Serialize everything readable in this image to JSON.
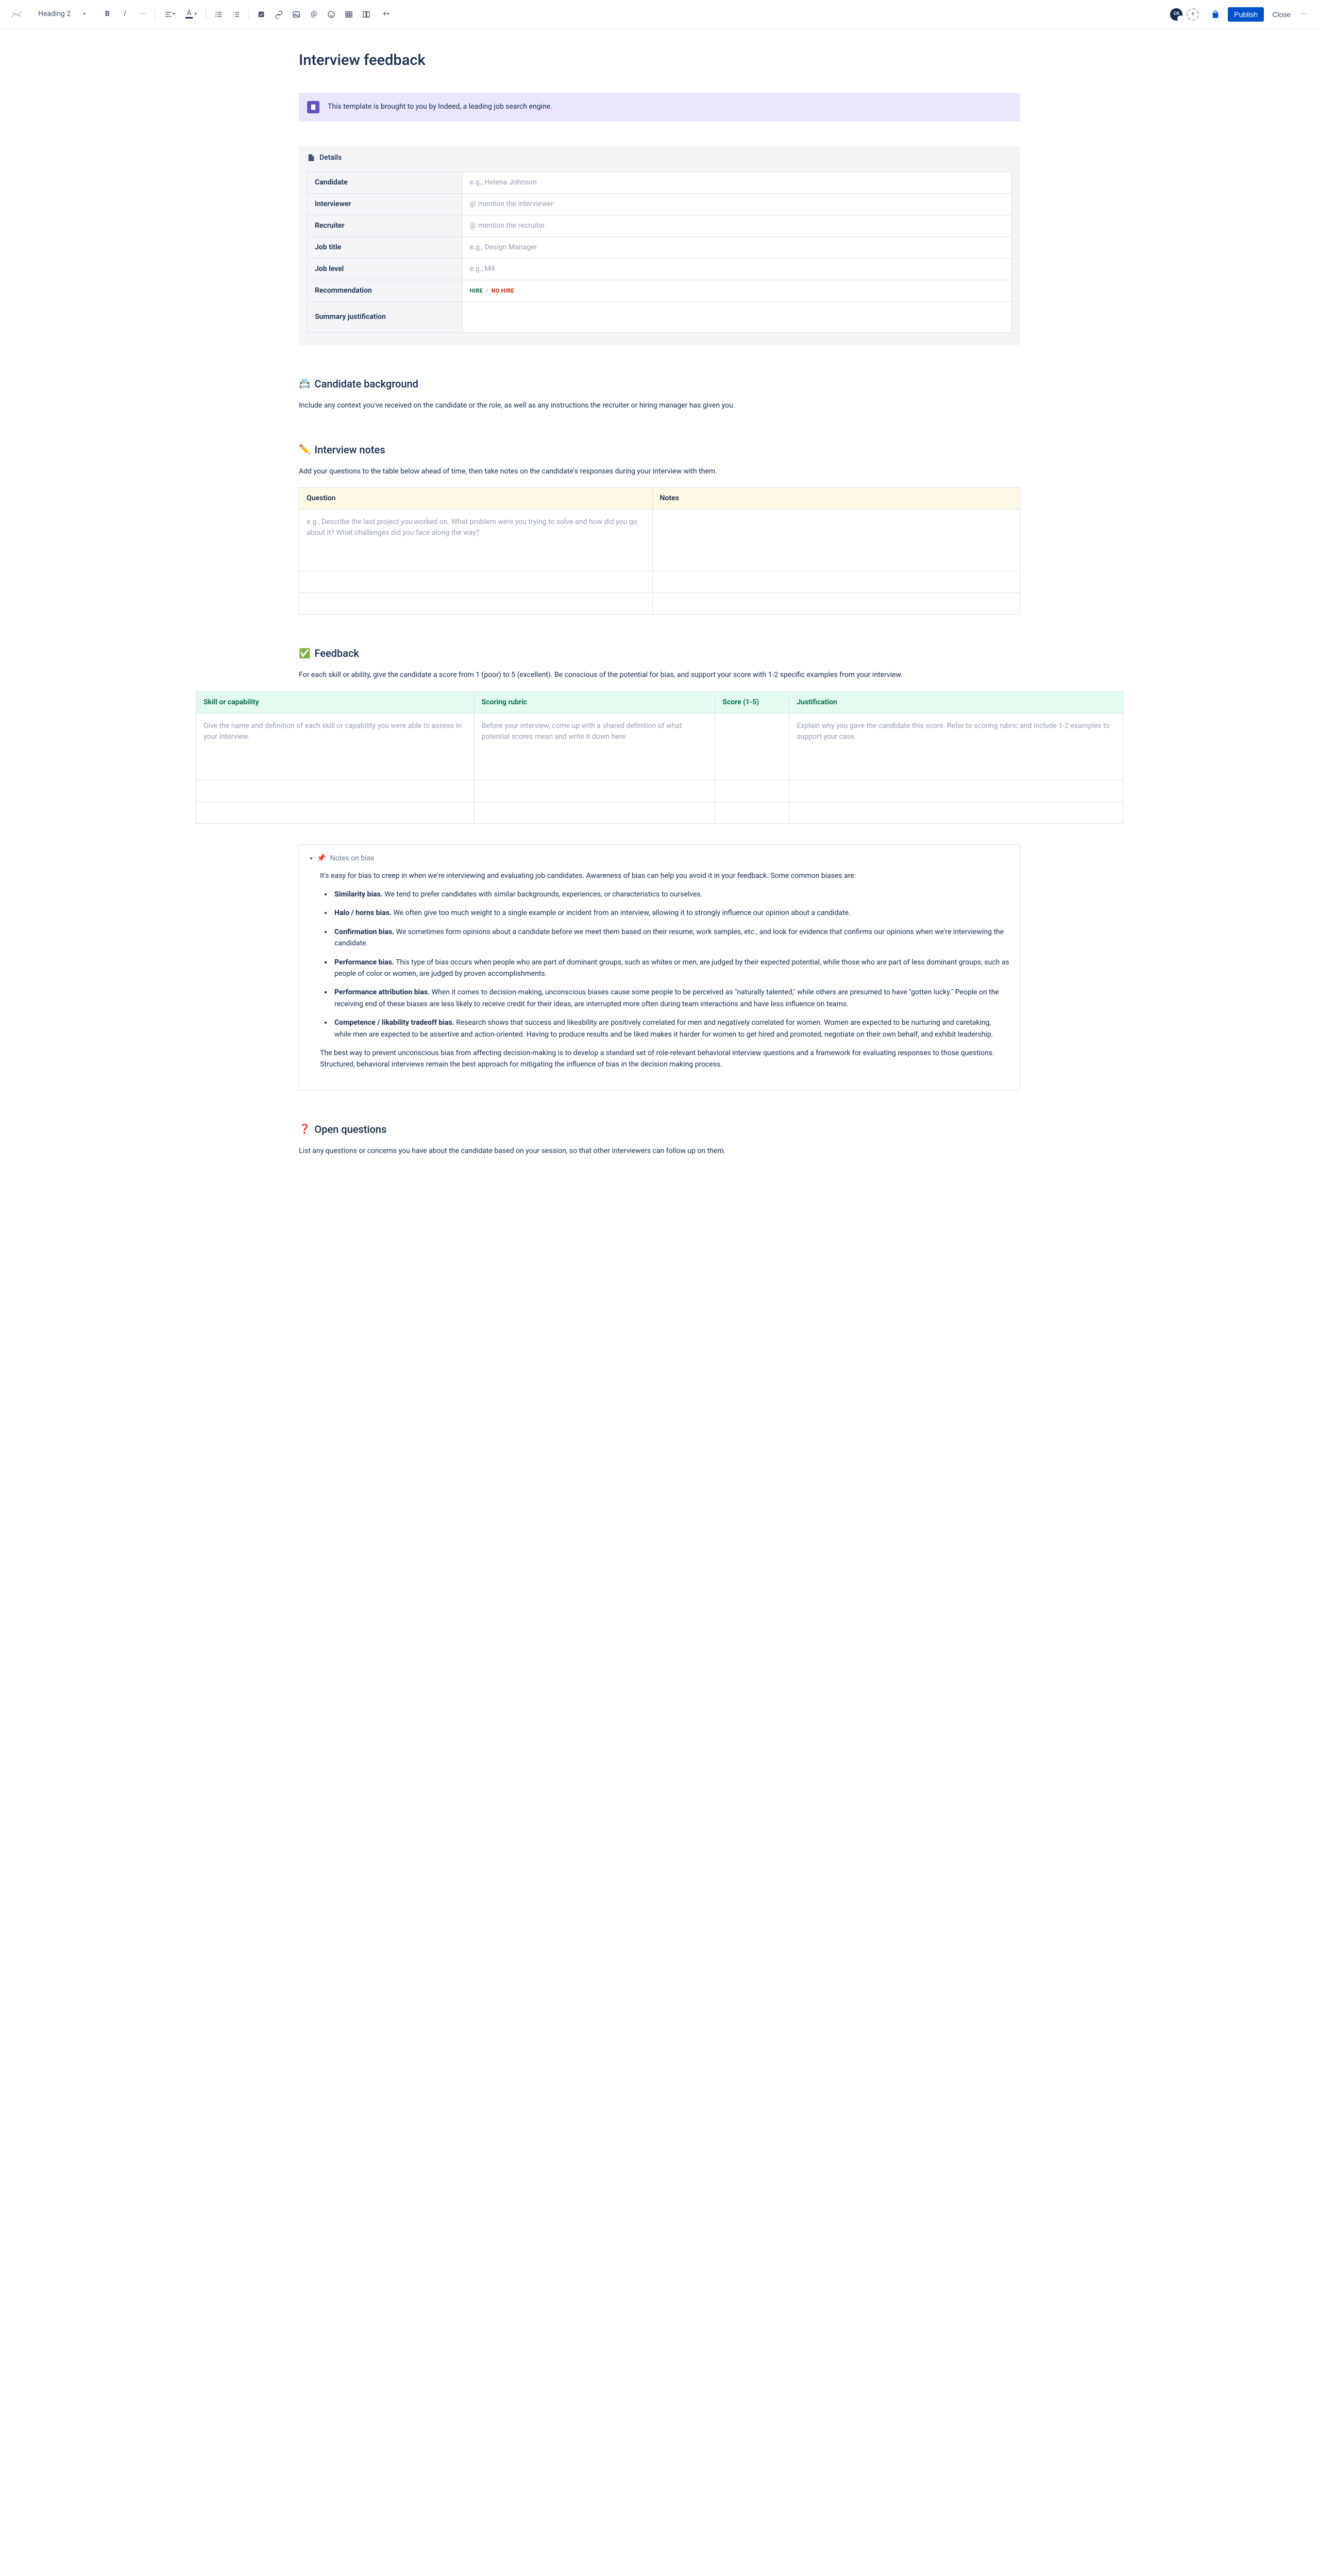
{
  "toolbar": {
    "heading": "Heading 2",
    "avatar": "CK",
    "publish": "Publish",
    "close": "Close"
  },
  "title": "Interview feedback",
  "callout": "This template is brought to you by Indeed, a leading job search engine.",
  "panel": {
    "title": "Details"
  },
  "details": {
    "rows": [
      {
        "label": "Candidate",
        "value": "e.g., Helena Johnson"
      },
      {
        "label": "Interviewer",
        "value": "@ mention the interviewer"
      },
      {
        "label": "Recruiter",
        "value": "@ mention the recruiter"
      },
      {
        "label": "Job title",
        "value": "e.g., Design Manager"
      },
      {
        "label": "Job level",
        "value": "e.g., M4"
      }
    ],
    "rec_label": "Recommendation",
    "hire": "HIRE",
    "nohire": "NO HIRE",
    "summary_label": "Summary justification"
  },
  "sections": {
    "bg": {
      "emoji": "📇",
      "title": "Candidate background",
      "text": "Include any context you've received on the candidate or the role, as well as any instructions the recruiter or hiring manager has given you."
    },
    "notes": {
      "emoji": "✏️",
      "title": "Interview notes",
      "text": "Add your questions to the table below ahead of time, then take notes on the candidate's responses during your interview with them.",
      "th1": "Question",
      "th2": "Notes",
      "example": "e.g., Describe the last project you worked on. What problem were you trying to solve and how did you go about it? What challenges did you face along the way?"
    },
    "fb": {
      "emoji": "✅",
      "title": "Feedback",
      "text": "For each skill or ability, give the candidate a score from 1 (poor) to 5 (excellent). Be conscious of the potential for bias, and support your score with 1-2 specific examples from your interview.",
      "th1": "Skill or capability",
      "th2": "Scoring rubric",
      "th3": "Score (1-5)",
      "th4": "Justification",
      "c1": "Give the name and definition of each skill or capability you were able to assess in your interview.",
      "c2": "Before your interview, come up with a shared definition of what potential scores mean and write it down here.",
      "c4": "Explain why you gave the candidate this score. Refer to scoring rubric and include 1-2 examples to support your case."
    },
    "open": {
      "emoji": "❓",
      "title": "Open questions",
      "text": "List any questions or concerns you have about the candidate based on your session, so that other interviewers can follow up on them."
    }
  },
  "bias": {
    "emoji": "📌",
    "title": "Notes on bias",
    "intro": "It's easy for bias to creep in when we're interviewing and evaluating job candidates. Awareness of bias can help you avoid it in your feedback. Some common biases are:",
    "items": [
      {
        "b": "Similarity bias.",
        "t": " We tend to prefer candidates with similar backgrounds, experiences, or characteristics to ourselves."
      },
      {
        "b": "Halo / horns bias.",
        "t": " We often give too much weight to a single example or incident from an interview, allowing it to strongly influence our opinion about a candidate."
      },
      {
        "b": "Confirmation bias.",
        "t": " We sometimes form opinions about a candidate before we meet them based on their resume, work samples, etc., and look for evidence that confirms our opinions when we're interviewing the candidate."
      },
      {
        "b": "Performance bias.",
        "t": " This type of bias occurs when people who are part of dominant groups, such as whites or men, are judged by their expected potential, while those who are part of less dominant groups, such as people of color or women, are judged by proven accomplishments."
      },
      {
        "b": "Performance attribution bias.",
        "t": " When it comes to decision-making, unconscious biases cause some people to be perceived as \"naturally talented,\" while others are presumed to have \"gotten lucky.\" People on the receiving end of these biases are less likely to receive credit for their ideas, are interrupted more often during team interactions and have less influence on teams."
      },
      {
        "b": "Competence / likability tradeoff bias.",
        "t": " Research shows that success and likeability are positively correlated for men and negatively correlated for women. Women are expected to be nurturing and caretaking, while men are expected to be assertive and action-oriented. Having to produce results and be liked makes it harder for women to get hired and promoted, negotiate on their own behalf, and exhibit leadership."
      }
    ],
    "outro": "The best way to prevent unconscious bias from affecting decision-making is to develop a standard set of role-relevant behavioral interview questions and a framework for evaluating responses to those questions. Structured, behavioral interviews remain the best approach for mitigating the influence of bias in the decision making process."
  }
}
